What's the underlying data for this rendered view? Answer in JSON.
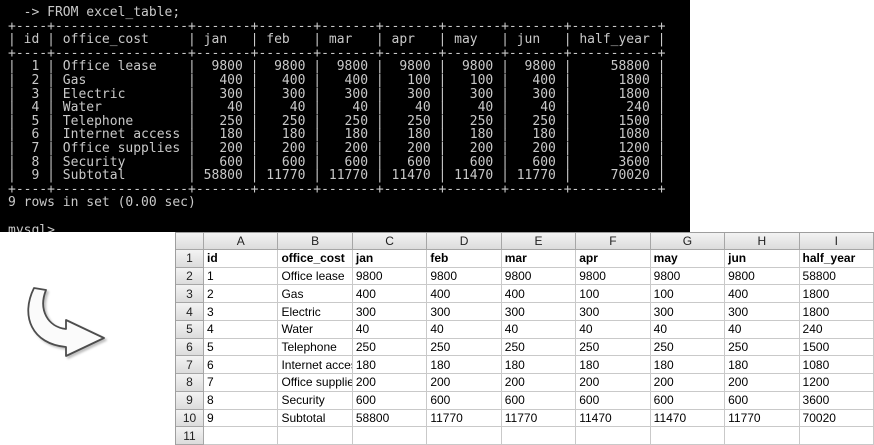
{
  "terminal": {
    "command": "  -> FROM excel_table;",
    "table": {
      "columns": [
        {
          "label": "id",
          "width": 2,
          "align": "right"
        },
        {
          "label": "office_cost",
          "width": 15,
          "align": "left"
        },
        {
          "label": "jan",
          "width": 5,
          "align": "right"
        },
        {
          "label": "feb",
          "width": 5,
          "align": "right"
        },
        {
          "label": "mar",
          "width": 5,
          "align": "right"
        },
        {
          "label": "apr",
          "width": 5,
          "align": "right"
        },
        {
          "label": "may",
          "width": 5,
          "align": "right"
        },
        {
          "label": "jun",
          "width": 5,
          "align": "right"
        },
        {
          "label": "half_year",
          "width": 9,
          "align": "right"
        }
      ],
      "rows": [
        [
          "1",
          "Office lease",
          "9800",
          "9800",
          "9800",
          "9800",
          "9800",
          "9800",
          "58800"
        ],
        [
          "2",
          "Gas",
          "400",
          "400",
          "400",
          "100",
          "100",
          "400",
          "1800"
        ],
        [
          "3",
          "Electric",
          "300",
          "300",
          "300",
          "300",
          "300",
          "300",
          "1800"
        ],
        [
          "4",
          "Water",
          "40",
          "40",
          "40",
          "40",
          "40",
          "40",
          "240"
        ],
        [
          "5",
          "Telephone",
          "250",
          "250",
          "250",
          "250",
          "250",
          "250",
          "1500"
        ],
        [
          "6",
          "Internet access",
          "180",
          "180",
          "180",
          "180",
          "180",
          "180",
          "1080"
        ],
        [
          "7",
          "Office supplies",
          "200",
          "200",
          "200",
          "200",
          "200",
          "200",
          "1200"
        ],
        [
          "8",
          "Security",
          "600",
          "600",
          "600",
          "600",
          "600",
          "600",
          "3600"
        ],
        [
          "9",
          "Subtotal",
          "58800",
          "11770",
          "11770",
          "11470",
          "11470",
          "11770",
          "70020"
        ]
      ]
    },
    "status": "9 rows in set (0.00 sec)",
    "prompt": "mysql>"
  },
  "spreadsheet": {
    "column_letters": [
      "A",
      "B",
      "C",
      "D",
      "E",
      "F",
      "G",
      "H",
      "I"
    ],
    "row_numbers": [
      "1",
      "2",
      "3",
      "4",
      "5",
      "6",
      "7",
      "8",
      "9",
      "10",
      "11"
    ],
    "cell_rows": [
      [
        "id",
        "office_cost",
        "jan",
        "feb",
        "mar",
        "apr",
        "may",
        "jun",
        "half_year"
      ],
      [
        "1",
        "Office lease",
        "9800",
        "9800",
        "9800",
        "9800",
        "9800",
        "9800",
        "58800"
      ],
      [
        "2",
        "Gas",
        "400",
        "400",
        "400",
        "100",
        "100",
        "400",
        "1800"
      ],
      [
        "3",
        "Electric",
        "300",
        "300",
        "300",
        "300",
        "300",
        "300",
        "1800"
      ],
      [
        "4",
        "Water",
        "40",
        "40",
        "40",
        "40",
        "40",
        "40",
        "240"
      ],
      [
        "5",
        "Telephone",
        "250",
        "250",
        "250",
        "250",
        "250",
        "250",
        "1500"
      ],
      [
        "6",
        "Internet access",
        "180",
        "180",
        "180",
        "180",
        "180",
        "180",
        "1080"
      ],
      [
        "7",
        "Office supplies",
        "200",
        "200",
        "200",
        "200",
        "200",
        "200",
        "1200"
      ],
      [
        "8",
        "Security",
        "600",
        "600",
        "600",
        "600",
        "600",
        "600",
        "3600"
      ],
      [
        "9",
        "Subtotal",
        "58800",
        "11770",
        "11770",
        "11470",
        "11470",
        "11770",
        "70020"
      ],
      [
        "",
        "",
        "",
        "",
        "",
        "",
        "",
        "",
        ""
      ]
    ]
  }
}
